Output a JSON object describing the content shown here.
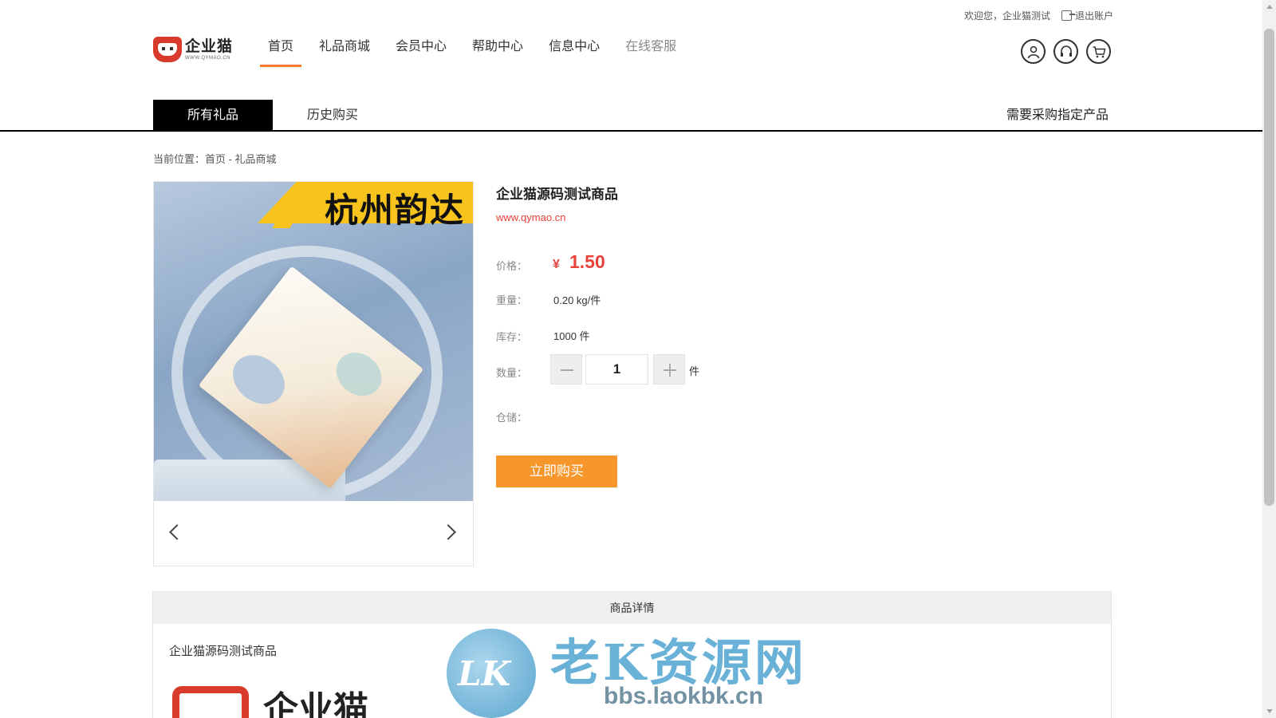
{
  "topbar": {
    "welcome": "欢迎您，企业猫测试",
    "logout": "退出账户"
  },
  "logo": {
    "name": "企业猫",
    "url": "WWW.QYMAO.CN"
  },
  "nav": {
    "items": [
      {
        "label": "首页"
      },
      {
        "label": "礼品商城"
      },
      {
        "label": "会员中心"
      },
      {
        "label": "帮助中心"
      },
      {
        "label": "信息中心"
      },
      {
        "label": "在线客服"
      }
    ]
  },
  "header_icons": [
    "user-icon",
    "headset-icon",
    "cart-icon"
  ],
  "tabs": {
    "all_gifts": "所有礼品",
    "history": "历史购买",
    "request": "需要采购指定产品"
  },
  "breadcrumb": "当前位置：首页 - 礼品商城",
  "gallery": {
    "banner_text": "杭州韵达"
  },
  "product": {
    "title": "企业猫源码测试商品",
    "site": "www.qymao.cn",
    "price_label": "价格：",
    "currency": "¥",
    "price": "1.50",
    "weight_label": "重量：",
    "weight": "0.20 kg/件",
    "stock_label": "库存：",
    "stock": "1000 件",
    "quantity_label": "数量：",
    "quantity": "1",
    "quantity_unit": "件",
    "warehouse_label": "仓储：",
    "buy_label": "立即购买"
  },
  "detail": {
    "header": "商品详情",
    "name": "企业猫源码测试商品",
    "logo_text": "企业猫"
  },
  "watermark": {
    "badge": "LK",
    "title": "老K资源网",
    "url": "bbs.laokbk.cn"
  },
  "colors": {
    "accent_orange": "#f7962b",
    "price_red": "#e8413a",
    "nav_underline": "#ef7a2e"
  }
}
